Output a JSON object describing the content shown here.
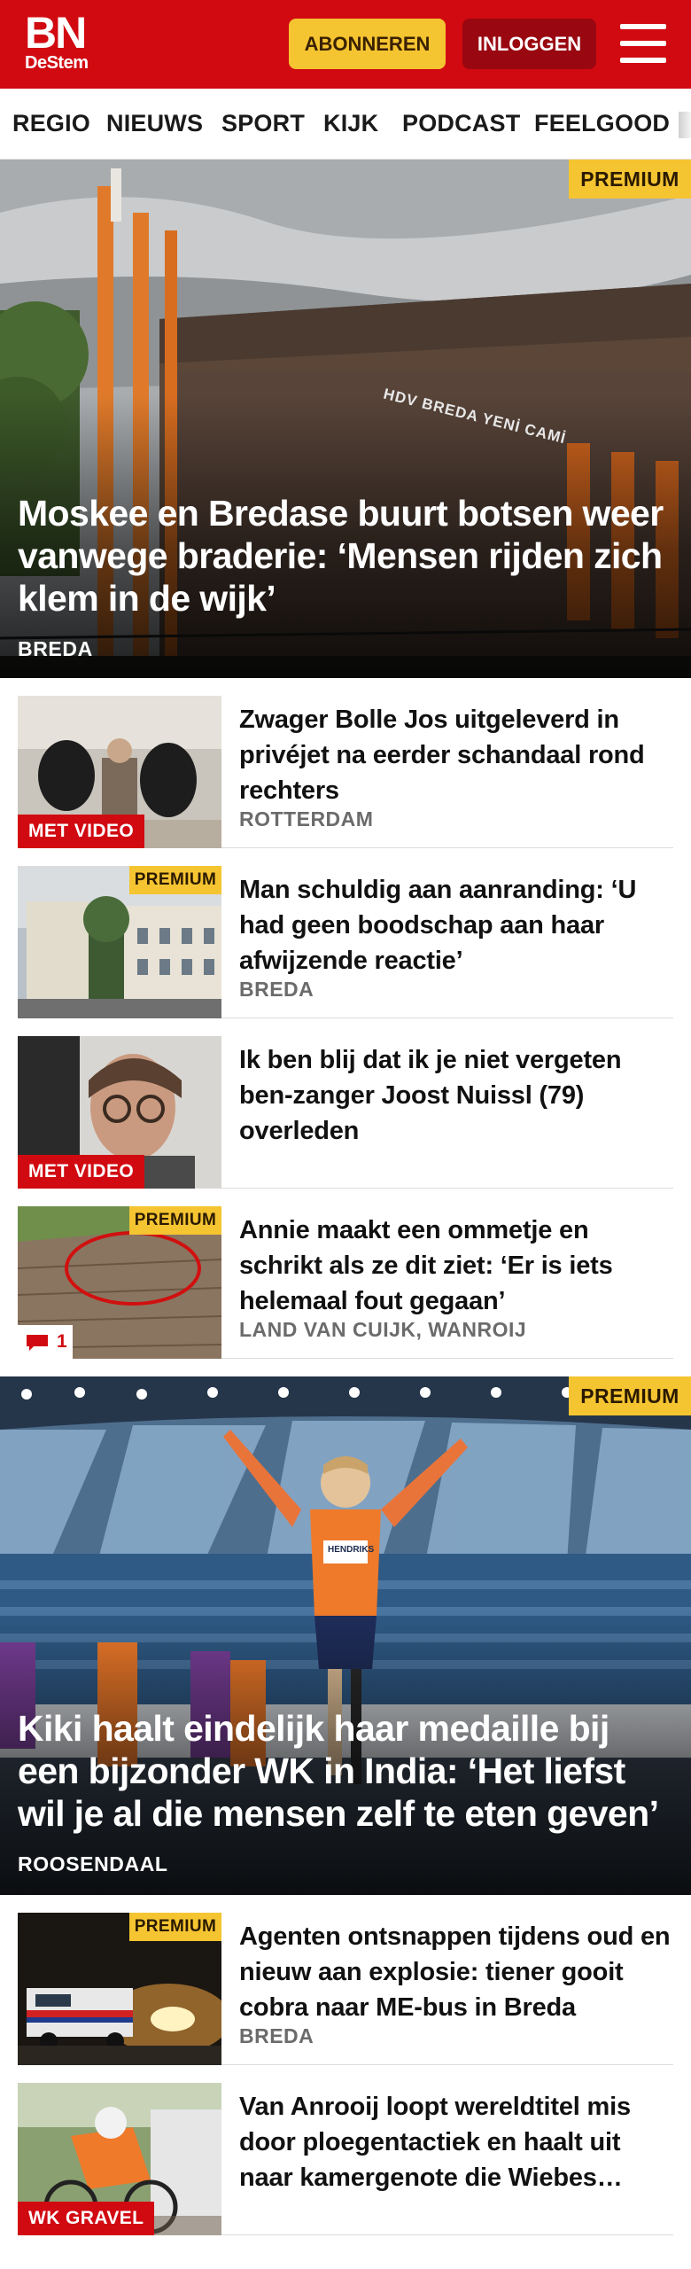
{
  "header": {
    "logo_main": "BN",
    "logo_sub": "DeStem",
    "subscribe_label": "ABONNEREN",
    "login_label": "INLOGGEN",
    "menu_icon": "hamburger-menu-icon",
    "brand_color": "#d10a11",
    "subscribe_color": "#f5c431",
    "login_color": "#990710"
  },
  "nav": {
    "items": [
      "REGIO",
      "NIEUWS",
      "SPORT",
      "KIJK",
      "PODCAST",
      "FEELGOOD"
    ]
  },
  "articles": [
    {
      "kind": "hero",
      "badge": "PREMIUM",
      "title": "Moskee en Bredase buurt botsen weer vanwege braderie: ‘Mensen rijden zich klem in de wijk’",
      "location": "BREDA",
      "sign_text": "HDV BREDA YENİ CAMİ"
    },
    {
      "kind": "list",
      "label": "MET VIDEO",
      "title": "Zwager Bolle Jos uitgeleverd in privéjet na eerder schandaal rond rechters",
      "location": "ROTTERDAM"
    },
    {
      "kind": "list",
      "badge": "PREMIUM",
      "title": "Man schuldig aan aanranding: ‘U had geen boodschap aan haar afwijzende reactie’",
      "location": "BREDA"
    },
    {
      "kind": "list",
      "label": "MET VIDEO",
      "title": "Ik ben blij dat ik je niet vergeten ben-zanger Joost Nuissl (79) overleden",
      "location": ""
    },
    {
      "kind": "list",
      "badge": "PREMIUM",
      "comment_count": "1",
      "title": "Annie maakt een ommetje en schrikt als ze dit ziet: ‘Er is iets helemaal fout gegaan’",
      "location": "LAND VAN CUIJK, WANROIJ"
    },
    {
      "kind": "hero",
      "badge": "PREMIUM",
      "title": "Kiki haalt eindelijk haar medaille bij een bijzonder WK in India: ‘Het liefst wil je al die mensen zelf te eten geven’",
      "location": "ROOSENDAAL",
      "bib_text": "HENDRIKS"
    },
    {
      "kind": "list",
      "badge": "PREMIUM",
      "title": "Agenten ontsnappen tijdens oud en nieuw aan explosie: tiener gooit cobra naar ME-bus in Breda",
      "location": "BREDA"
    },
    {
      "kind": "list",
      "label": "WK GRAVEL",
      "title": "Van Anrooij loopt wereldtitel mis door ploegentactiek en haalt uit naar kamergenote die Wiebes…",
      "location": ""
    }
  ]
}
